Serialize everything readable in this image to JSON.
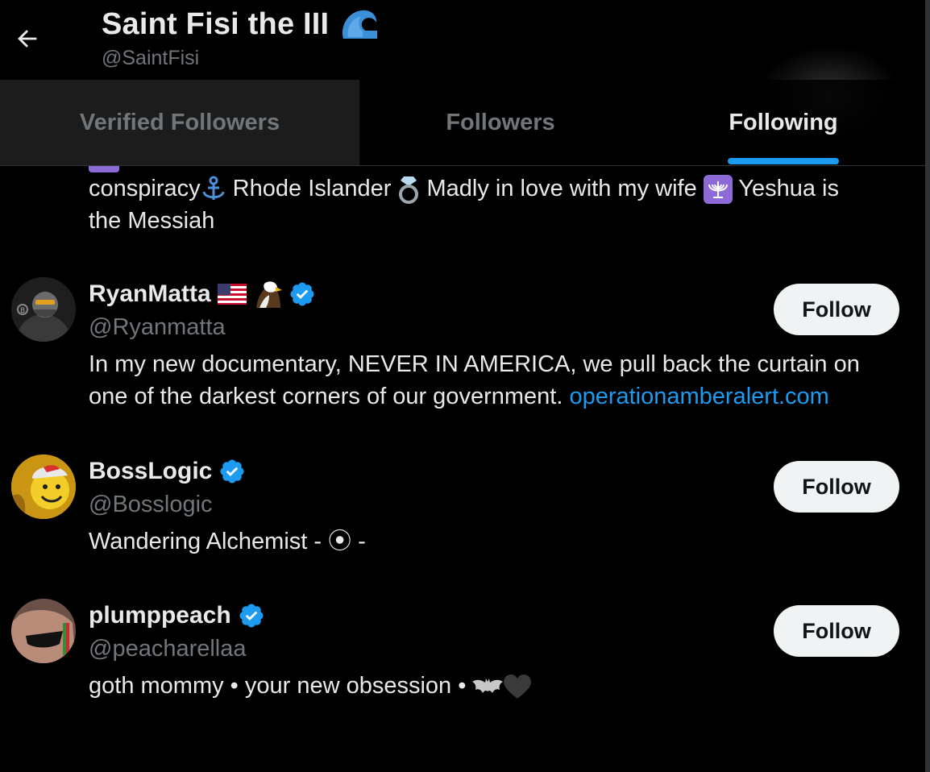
{
  "profile": {
    "name": "Saint Fisi the III",
    "handle": "@SaintFisi",
    "badge_icon": "wave-icon"
  },
  "tabs": [
    {
      "label": "Verified Followers",
      "active": false
    },
    {
      "label": "Followers",
      "active": false
    },
    {
      "label": "Following",
      "active": true
    }
  ],
  "partial_item": {
    "bio_line1_a": "conspiracy",
    "bio_line1_b": " Rhode Islander ",
    "bio_line1_c": " Madly in love with my wife ",
    "bio_line1_d": " Yeshua is",
    "bio_line2": "the Messiah"
  },
  "users": [
    {
      "name": "RyanMatta",
      "handle": "@Ryanmatta",
      "bio": "In my new documentary, NEVER IN AMERICA, we pull back the curtain on one of the darkest corners of our government. ",
      "bio_link": "operationamberalert.com",
      "follow_label": "Follow",
      "verified": true
    },
    {
      "name": "BossLogic",
      "handle": "@Bosslogic",
      "bio": "Wandering Alchemist - ⦿ -",
      "follow_label": "Follow",
      "verified": true
    },
    {
      "name": "plumppeach",
      "handle": "@peacharellaa",
      "bio": "goth mommy • your new obsession • ",
      "follow_label": "Follow",
      "verified": true
    }
  ],
  "colors": {
    "accent": "#1d9bf0",
    "background": "#000000",
    "text": "#e7e9ea",
    "muted": "#71767b",
    "button": "#eff3f4"
  }
}
